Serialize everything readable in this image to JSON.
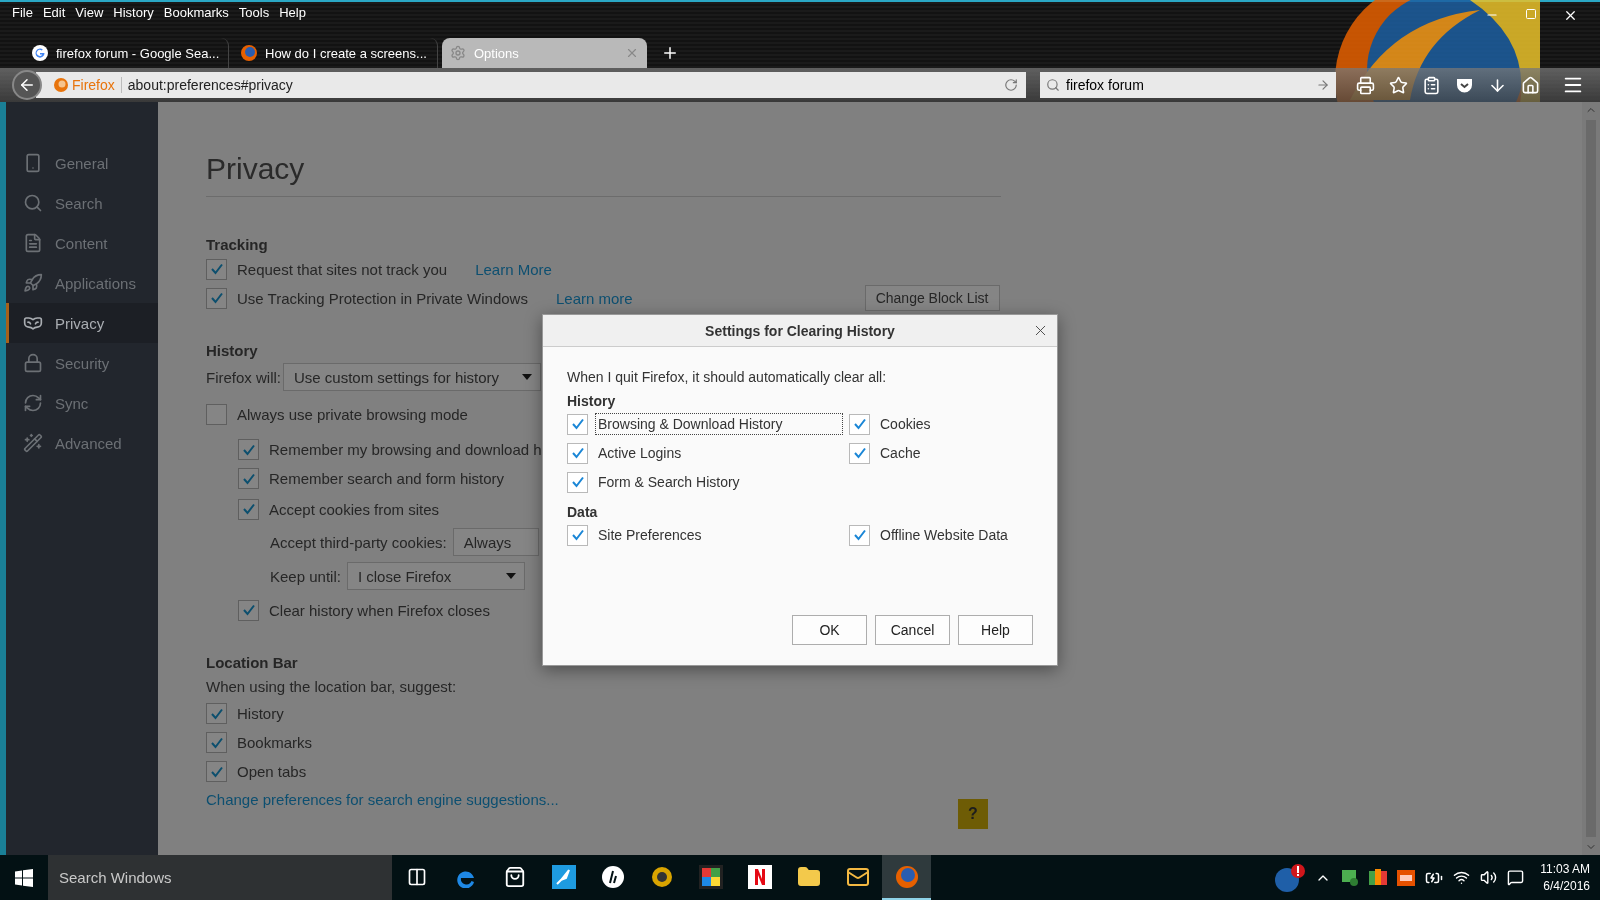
{
  "menu": [
    "File",
    "Edit",
    "View",
    "History",
    "Bookmarks",
    "Tools",
    "Help"
  ],
  "tabs": [
    {
      "title": "firefox forum - Google Sea...",
      "selected": false
    },
    {
      "title": "How do I create a screens...",
      "selected": false
    },
    {
      "title": "Options",
      "selected": true
    }
  ],
  "navbar": {
    "identity": "Firefox",
    "url": "about:preferences#privacy",
    "search": "firefox forum"
  },
  "sidebar": [
    {
      "label": "General",
      "selected": false
    },
    {
      "label": "Search",
      "selected": false
    },
    {
      "label": "Content",
      "selected": false
    },
    {
      "label": "Applications",
      "selected": false
    },
    {
      "label": "Privacy",
      "selected": true
    },
    {
      "label": "Security",
      "selected": false
    },
    {
      "label": "Sync",
      "selected": false
    },
    {
      "label": "Advanced",
      "selected": false
    }
  ],
  "page": {
    "title": "Privacy",
    "tracking": {
      "heading": "Tracking",
      "options": [
        {
          "label": "Request that sites not track you",
          "checked": true,
          "link": "Learn More"
        },
        {
          "label": "Use Tracking Protection in Private Windows",
          "checked": true,
          "link": "Learn more"
        }
      ],
      "button": "Change Block List"
    },
    "history": {
      "heading": "History",
      "will_label": "Firefox will:",
      "will_value": "Use custom settings for history",
      "private_mode": {
        "label": "Always use private browsing mode",
        "checked": false
      },
      "options": [
        {
          "label": "Remember my browsing and download h",
          "checked": true
        },
        {
          "label": "Remember search and form history",
          "checked": true
        },
        {
          "label": "Accept cookies from sites",
          "checked": true
        }
      ],
      "third_party_label": "Accept third-party cookies:",
      "third_party_value": "Always",
      "keep_until_label": "Keep until:",
      "keep_until_value": "I close Firefox",
      "clear": {
        "label": "Clear history when Firefox closes",
        "checked": true
      }
    },
    "location_bar": {
      "heading": "Location Bar",
      "intro": "When using the location bar, suggest:",
      "options": [
        {
          "label": "History",
          "checked": true
        },
        {
          "label": "Bookmarks",
          "checked": true
        },
        {
          "label": "Open tabs",
          "checked": true
        }
      ],
      "link": "Change preferences for search engine suggestions..."
    },
    "help_button": "?"
  },
  "dialog": {
    "title": "Settings for Clearing History",
    "intro": "When I quit Firefox, it should automatically clear all:",
    "sections": [
      {
        "heading": "History",
        "items": [
          {
            "label": "Browsing & Download History",
            "checked": true,
            "focused": true
          },
          {
            "label": "Cookies",
            "checked": true,
            "focused": false
          },
          {
            "label": "Active Logins",
            "checked": true,
            "focused": false
          },
          {
            "label": "Cache",
            "checked": true,
            "focused": false
          },
          {
            "label": "Form & Search History",
            "checked": true,
            "focused": false
          }
        ]
      },
      {
        "heading": "Data",
        "items": [
          {
            "label": "Site Preferences",
            "checked": true,
            "focused": false
          },
          {
            "label": "Offline Website Data",
            "checked": true,
            "focused": false
          }
        ]
      }
    ],
    "buttons": [
      "OK",
      "Cancel",
      "Help"
    ]
  },
  "taskbar": {
    "search": "Search Windows",
    "apps": [
      {
        "selected": false
      },
      {
        "selected": false
      },
      {
        "selected": false
      },
      {
        "selected": false
      },
      {
        "selected": false
      },
      {
        "selected": false
      },
      {
        "selected": false
      },
      {
        "selected": false
      },
      {
        "selected": false
      },
      {
        "selected": false
      },
      {
        "selected": true
      }
    ],
    "time": "11:03 AM",
    "date": "6/4/2016"
  }
}
